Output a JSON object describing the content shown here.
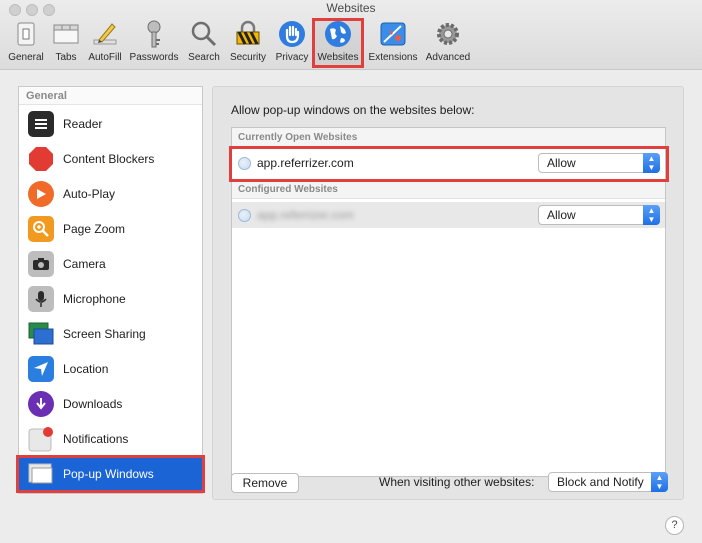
{
  "window": {
    "title": "Websites"
  },
  "toolbar": {
    "items": [
      {
        "label": "General"
      },
      {
        "label": "Tabs"
      },
      {
        "label": "AutoFill"
      },
      {
        "label": "Passwords"
      },
      {
        "label": "Search"
      },
      {
        "label": "Security"
      },
      {
        "label": "Privacy"
      },
      {
        "label": "Websites"
      },
      {
        "label": "Extensions"
      },
      {
        "label": "Advanced"
      }
    ],
    "active": "Websites"
  },
  "sidebar": {
    "header": "General",
    "items": [
      {
        "label": "Reader",
        "icon": "reader-icon"
      },
      {
        "label": "Content Blockers",
        "icon": "stop-sign-icon"
      },
      {
        "label": "Auto-Play",
        "icon": "play-icon"
      },
      {
        "label": "Page Zoom",
        "icon": "zoom-icon"
      },
      {
        "label": "Camera",
        "icon": "camera-icon"
      },
      {
        "label": "Microphone",
        "icon": "microphone-icon"
      },
      {
        "label": "Screen Sharing",
        "icon": "screen-sharing-icon"
      },
      {
        "label": "Location",
        "icon": "location-arrow-icon"
      },
      {
        "label": "Downloads",
        "icon": "download-icon"
      },
      {
        "label": "Notifications",
        "icon": "notification-icon"
      },
      {
        "label": "Pop-up Windows",
        "icon": "popup-window-icon"
      }
    ],
    "selected": "Pop-up Windows"
  },
  "main": {
    "prompt": "Allow pop-up windows on the websites below:",
    "current_header": "Currently Open Websites",
    "current_sites": [
      {
        "domain": "app.referrizer.com",
        "setting": "Allow"
      }
    ],
    "configured_header": "Configured Websites",
    "configured_sites": [
      {
        "domain": "app.referrizer.com",
        "setting": "Allow"
      }
    ],
    "remove_button": "Remove",
    "other_label": "When visiting other websites:",
    "other_setting": "Block and Notify"
  },
  "help_label": "?",
  "colors": {
    "accent": "#1a64d6",
    "highlight": "#e0403d"
  }
}
